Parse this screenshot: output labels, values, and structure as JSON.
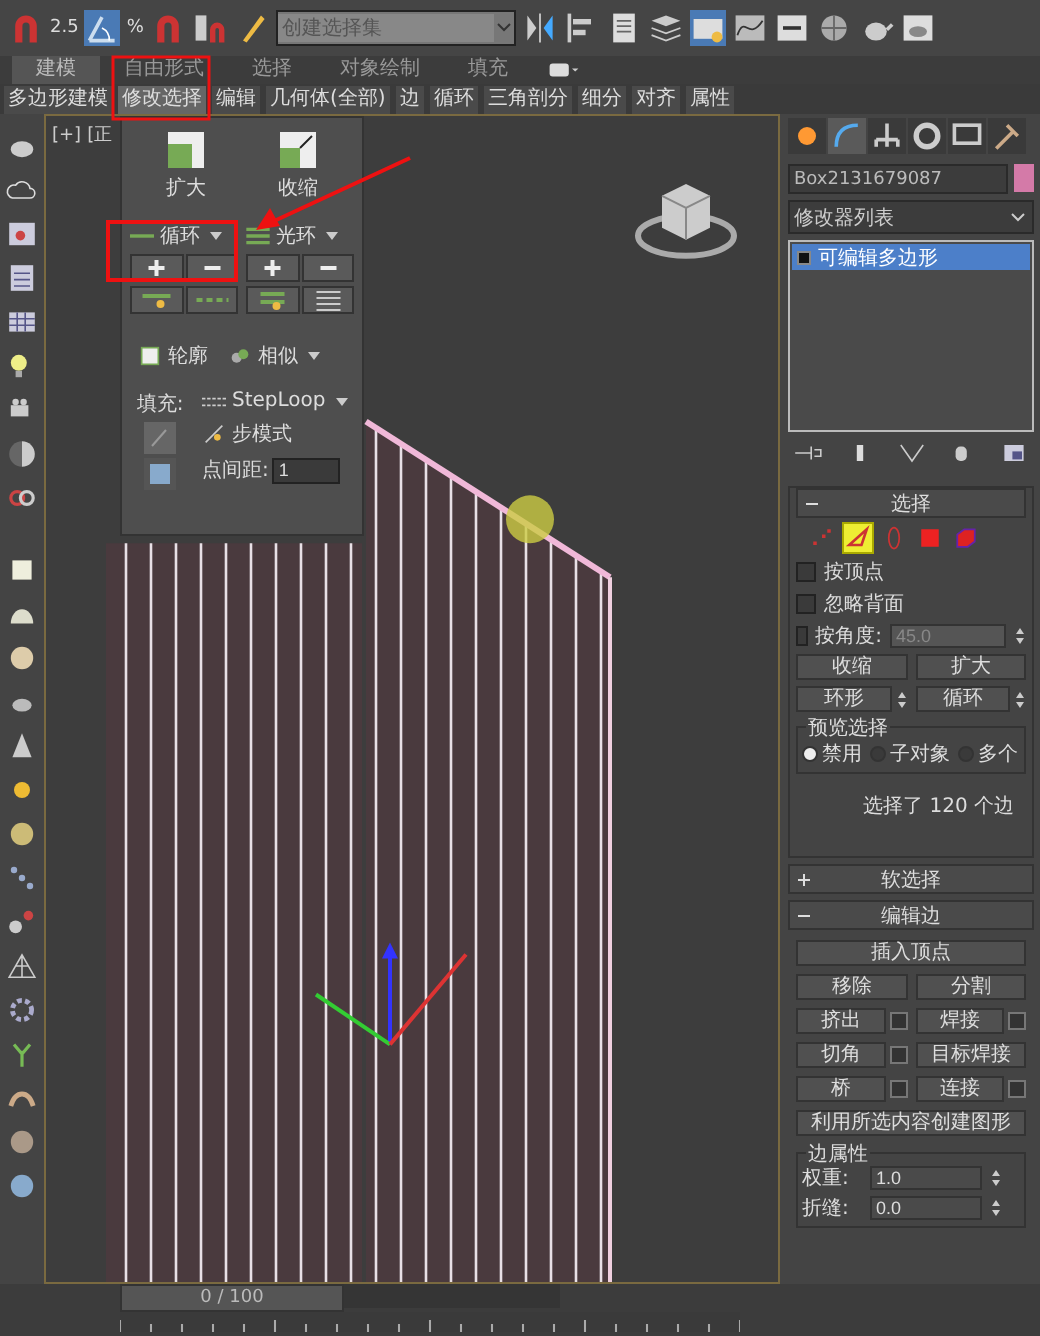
{
  "toolbar": {
    "snap_value": "2.5",
    "percent_label": "%",
    "selection_set": {
      "placeholder": "创建选择集"
    }
  },
  "ribbon": {
    "tabs": [
      {
        "label": "建模",
        "selected": true
      },
      {
        "label": "自由形式",
        "selected": false
      },
      {
        "label": "选择",
        "selected": false
      },
      {
        "label": "对象绘制",
        "selected": false
      },
      {
        "label": "填充",
        "selected": false
      }
    ],
    "subtabs": [
      {
        "label": "多边形建模",
        "selected": false
      },
      {
        "label": "修改选择",
        "selected": true
      },
      {
        "label": "编辑",
        "selected": false
      },
      {
        "label": "几何体(全部)",
        "selected": false
      },
      {
        "label": "边",
        "selected": false
      },
      {
        "label": "循环",
        "selected": false
      },
      {
        "label": "三角剖分",
        "selected": false
      },
      {
        "label": "细分",
        "selected": false
      },
      {
        "label": "对齐",
        "selected": false
      },
      {
        "label": "属性",
        "selected": false
      }
    ]
  },
  "viewport": {
    "labels": [
      "[+]",
      "[正"
    ]
  },
  "popup": {
    "grow": "扩大",
    "shrink": "收缩",
    "loop": "循环",
    "ring": "光环",
    "outline": "轮廓",
    "similar": "相似",
    "fill_label": "填充:",
    "steploop": "StepLoop",
    "step_mode": "步模式",
    "spacing_label": "点间距:",
    "spacing_value": "1"
  },
  "panel": {
    "tabs": [
      {
        "selected": false
      },
      {
        "selected": true
      },
      {
        "selected": false
      },
      {
        "selected": false
      },
      {
        "selected": false
      },
      {
        "selected": false
      }
    ],
    "object_name": "Box2131679087",
    "modifier_list": "修改器列表",
    "stack": [
      {
        "label": "可编辑多边形",
        "selected": true
      }
    ]
  },
  "selection": {
    "title": "选择",
    "subobjects": [
      {
        "selected": false
      },
      {
        "selected": true
      },
      {
        "selected": false
      },
      {
        "selected": false
      },
      {
        "selected": false
      }
    ],
    "checkboxes": [
      {
        "label": "按顶点",
        "checked": false
      },
      {
        "label": "忽略背面",
        "checked": false
      },
      {
        "label": "按角度:",
        "checked": false
      }
    ],
    "angle": "45.0",
    "buttons": [
      "收缩",
      "扩大"
    ],
    "spin_buttons": [
      "环形",
      "循环"
    ],
    "preview": {
      "title": "预览选择",
      "options": [
        {
          "label": "禁用",
          "selected": true
        },
        {
          "label": "子对象",
          "selected": false
        },
        {
          "label": "多个",
          "selected": false
        }
      ]
    },
    "status": "选择了 120 个边"
  },
  "rollouts": [
    {
      "title": "软选择",
      "expanded": false
    },
    {
      "title": "编辑边",
      "expanded": true
    }
  ],
  "edit_edges": {
    "wide_top": "插入顶点",
    "pairs": [
      {
        "kind": "plain",
        "left": "移除",
        "right": "分割"
      },
      {
        "kind": "settings",
        "left": "挤出",
        "right": "焊接"
      },
      {
        "kind": "half",
        "left": "切角",
        "right": "目标焊接"
      },
      {
        "kind": "settings",
        "left": "桥",
        "right": "连接"
      }
    ],
    "wide_bottom": "利用所选内容创建图形",
    "group": "边属性",
    "fields": [
      {
        "label": "权重:",
        "value": "1.0"
      },
      {
        "label": "折缝:",
        "value": "0.0"
      }
    ]
  },
  "timeline": {
    "frame": "0 / 100",
    "level": 0
  }
}
